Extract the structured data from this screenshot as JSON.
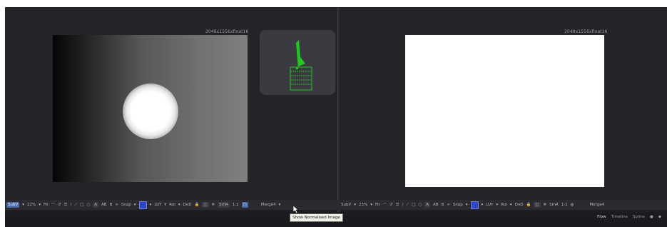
{
  "viewers": {
    "left": {
      "resolution_label": "2048x1556xfloat16"
    },
    "right": {
      "resolution_label": "2048x1556xfloat16"
    }
  },
  "toolbar_left": {
    "subv": "SubV",
    "zoom": "22%",
    "fit": "Fit",
    "a_label": "A",
    "ab_label": "AB",
    "b_label": "B",
    "snap": "Snap",
    "lut": "LUT",
    "roi": "RoI",
    "dod": "DoD",
    "smr": "SmR",
    "one_to_one": "1:1",
    "node_name": "Merge4"
  },
  "toolbar_right": {
    "subv": "SubV",
    "zoom": "23%",
    "fit": "Fit",
    "a_label": "A",
    "ab_label": "AB",
    "b_label": "B",
    "snap": "Snap",
    "lut": "LUT",
    "roi": "RoI",
    "dod": "DoD",
    "smr": "SmR",
    "one_to_one": "1:1",
    "node_name": "Merge4"
  },
  "statusbar": {
    "tabs": [
      "Flow",
      "Timeline",
      "Spline"
    ]
  },
  "tooltip": {
    "text": "Show Normalised Image"
  },
  "colors": {
    "accent": "#4a6aa8",
    "node_green": "#22c722",
    "background": "#1f1f23"
  }
}
